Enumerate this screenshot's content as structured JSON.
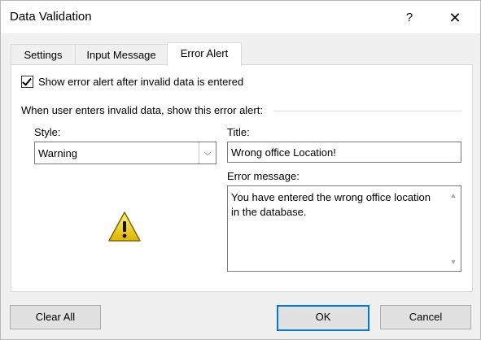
{
  "window": {
    "title": "Data Validation",
    "help_glyph": "?",
    "close_glyph": "✕"
  },
  "tabs": [
    {
      "label": "Settings",
      "active": false
    },
    {
      "label": "Input Message",
      "active": false
    },
    {
      "label": "Error Alert",
      "active": true
    }
  ],
  "error_alert": {
    "show_alert_checkbox": {
      "label": "Show error alert after invalid data is entered",
      "checked": true
    },
    "section_heading": "When user enters invalid data, show this error alert:",
    "style_label": "Style:",
    "style_value": "Warning",
    "style_icon": "warning-triangle-icon",
    "title_label": "Title:",
    "title_value": "Wrong office Location!",
    "message_label": "Error message:",
    "message_value": "You have entered the wrong office location in the database."
  },
  "buttons": {
    "clear_all": "Clear All",
    "ok": "OK",
    "cancel": "Cancel"
  },
  "colors": {
    "accent": "#0078d7",
    "warning_fill": "#f5d20a",
    "window_bg": "#f0f0f0"
  }
}
